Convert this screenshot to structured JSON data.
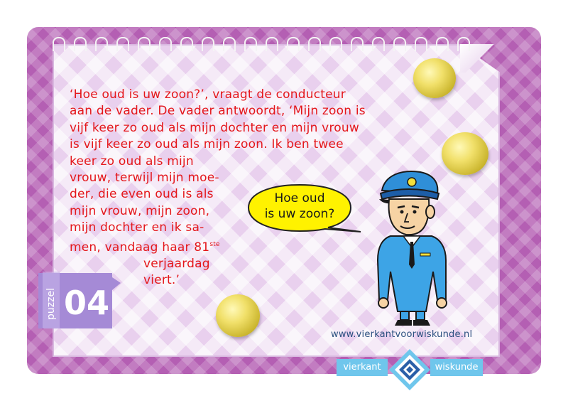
{
  "puzzle": {
    "word": "puzzel",
    "number": "04"
  },
  "story": {
    "lines": [
      "‘Hoe oud is uw zoon?’, vraagt de conducteur",
      "aan de vader. De vader antwoordt, ‘Mijn zoon is",
      "vijf keer zo oud als mijn dochter en mijn vrouw",
      "is vijf keer zo oud als mijn zoon. Ik ben twee",
      "keer zo oud als mijn",
      "vrouw, terwijl mijn moe-",
      "der, die even oud is als",
      "mijn vrouw, mijn zoon,",
      "mijn dochter en ik sa-",
      "men, vandaag haar 81"
    ],
    "ordinal_suffix": "ste",
    "line_11": "verjaardag",
    "line_12": "viert.’"
  },
  "speech_bubble": {
    "line1": "Hoe oud",
    "line2": "is uw zoon?"
  },
  "footer": {
    "url": "www.vierkantvoorwiskunde.nl",
    "logo_left": "vierkant",
    "logo_right": "wiskunde"
  },
  "colors": {
    "card": "#b45fb3",
    "text": "#e4171b",
    "bubble": "#fff200",
    "logo": "#6fc6ec",
    "tab": "#a58ad6"
  }
}
